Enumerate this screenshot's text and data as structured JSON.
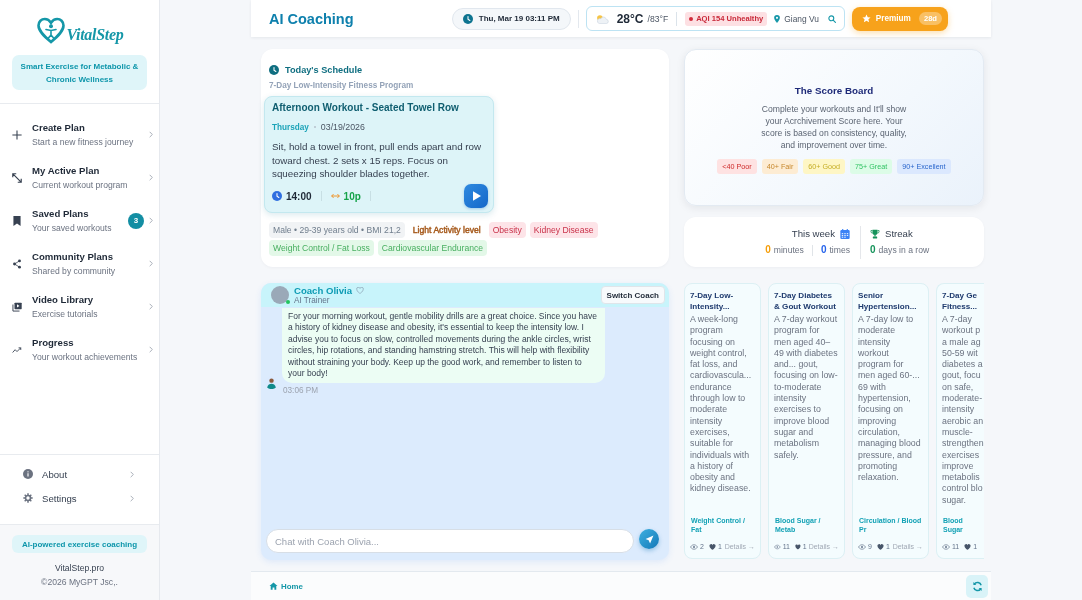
{
  "sidebar": {
    "logo": "VitalStep",
    "tagline": "Smart Exercise for Metabolic & Chronic Wellness",
    "nav_items": [
      {
        "title": "Create Plan",
        "subtitle": "Start a new fitness journey",
        "selected": false
      },
      {
        "title": "My Active Plan",
        "subtitle": "Current workout program",
        "selected": false
      },
      {
        "title": "Saved Plans",
        "subtitle": "Your saved workouts",
        "badge": "3",
        "selected": false
      },
      {
        "title": "Community Plans",
        "subtitle": "Shared by community",
        "selected": false
      },
      {
        "title": "Video Library",
        "subtitle": "Exercise tutorials",
        "selected": false
      },
      {
        "title": "Progress",
        "subtitle": "Your workout achievements",
        "selected": false
      }
    ],
    "bottom_items": [
      {
        "label": "About"
      },
      {
        "label": "Settings"
      }
    ],
    "footer": {
      "badge": "AI-powered exercise coaching",
      "site": "VitalStep.pro",
      "copyright": "©2026 MyGPT Jsc,."
    }
  },
  "header": {
    "title": "AI Coaching",
    "datetime": "Thu, Mar 19 03:11 PM",
    "weather": {
      "temperature": "28°C",
      "temperature_alt": "/83°F",
      "aqi": "AQI 154 Unhealthy",
      "location": "Giang Vu"
    },
    "premium": {
      "label": "Premium",
      "days": "28d"
    }
  },
  "schedule": {
    "title": "Today's Schedule",
    "program": "7-Day Low-Intensity Fitness Program",
    "workout": {
      "title": "Afternoon Workout - Seated Towel Row",
      "day": "Thursday",
      "date": "03/19/2026",
      "description": "Sit, hold a towel in front, pull ends apart and row toward chest. 2 sets x 15 reps. Focus on squeezing shoulder blades together.",
      "time": "14:00",
      "duration": "10p"
    },
    "tags": [
      {
        "text": "Male • 29-39 years old • BMI 21,2",
        "kind": "pill",
        "color": "#f1f3f5"
      },
      {
        "text": "Light Activity level",
        "kind": "plain",
        "color": "#a65a1c"
      },
      {
        "text": "Obesity",
        "kind": "pill",
        "color": "#fde4e8"
      },
      {
        "text": "Kidney Disease",
        "kind": "pill",
        "color": "#fde4e8"
      },
      {
        "text": "Weight Control / Fat Loss",
        "kind": "pill",
        "color": "#e3f8e8"
      },
      {
        "text": "Cardiovascular Endurance",
        "kind": "pill",
        "color": "#e3f8e8"
      }
    ]
  },
  "chat": {
    "coach": {
      "name": "Coach Olivia",
      "role": "AI Trainer",
      "online": true
    },
    "switch_button": "Switch Coach",
    "messages": [
      {
        "kind": "coach",
        "text": "For your morning workout, gentle mobility drills are a great choice. Since you have a history of kidney disease and obesity, it's essential to keep the intensity low. I advise you to focus on slow, controlled movements during the ankle circles, wrist circles, hip rotations, and standing hamstring stretch. This will help with flexibility without straining your body. Keep up the good work, and remember to listen to your body!",
        "time": "03:06 PM"
      }
    ],
    "input": {
      "placeholder": "Chat with Coach Olivia..."
    }
  },
  "score_board": {
    "title": "The Score Board",
    "description": "Complete your workouts and It'll show your Acrchivement Score here. Your score is based on consistency, quality, and improvement over time.",
    "levels": [
      {
        "label": "<40 Poor",
        "color": "#fee2e2"
      },
      {
        "label": "40+ Fair",
        "color": "#fdecd3"
      },
      {
        "label": "60+ Good",
        "color": "#fef6c5"
      },
      {
        "label": "75+ Great",
        "color": "#dcfce7"
      },
      {
        "label": "90+ Excellent",
        "color": "#dbe8fe"
      }
    ]
  },
  "stats": {
    "week": {
      "label": "This week",
      "minutes": "0",
      "minutes_unit": "minutes",
      "times": "0",
      "times_unit": "times"
    },
    "streak": {
      "label": "Streak",
      "days": "0",
      "days_unit": "days in a row"
    }
  },
  "programs": [
    {
      "kind": "full",
      "title": "7-Day Low-Intensity...",
      "description": "A week-long program focusing on weight control, fat loss, and cardiovascula... endurance through low to moderate intensity exercises, suitable for individuals with a history of obesity and kidney disease.",
      "tag": "Weight Control / Fat",
      "views": "2",
      "likes": "1",
      "details": "Details →"
    },
    {
      "kind": "full",
      "title": "7-Day Diabetes & Gout Workout",
      "description": "A 7-day workout program for men aged 40–49 with diabetes and... gout, focusing on low-to-moderate intensity exercises to improve blood sugar and metabolism safely.",
      "tag": "Blood Sugar / Metab",
      "views": "11",
      "likes": "1",
      "details": "Details →"
    },
    {
      "kind": "full",
      "title": "Senior Hypertension...",
      "description": "A 7-day low to moderate intensity workout program for men aged 60-... 69 with hypertension, focusing on improving circulation, managing blood pressure, and promoting relaxation.",
      "tag": "Circulation / Blood Pr",
      "views": "9",
      "likes": "1",
      "details": "Details →"
    },
    {
      "kind": "clipped",
      "title": "7-Day Ge\nFitness...",
      "description": "A 7-day\nworkout p\na male ag\n50-59 wit\ndiabetes a\ngout, focu\non safe,\nmoderate-\nintensity\naerobic an\nmuscle-\nstrengthen\nexercises\nimprove\nmetabolis\ncontrol blo\nsugar.",
      "tag": "Blood Sugar",
      "views": "11",
      "likes": "1"
    }
  ],
  "footer": {
    "home": "Home"
  }
}
